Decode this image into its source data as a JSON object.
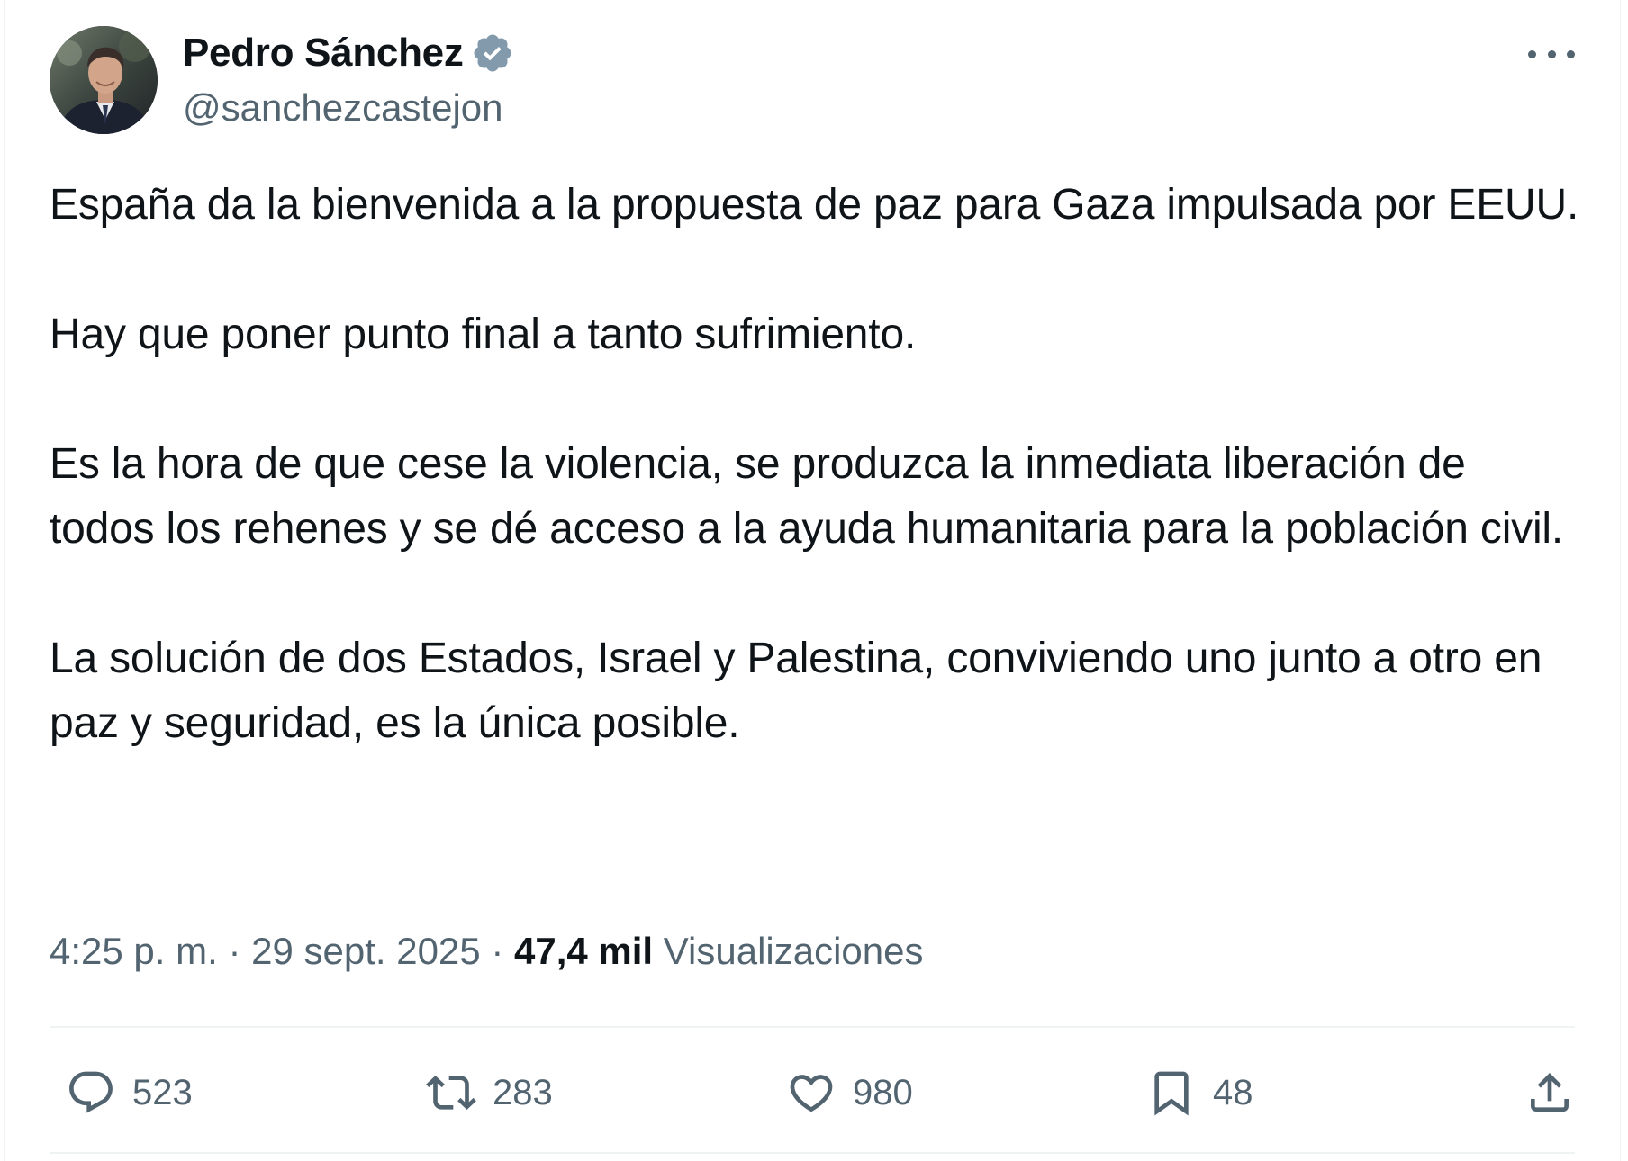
{
  "author": {
    "name": "Pedro Sánchez",
    "handle": "@sanchezcastejon",
    "verified": true
  },
  "icons": {
    "verified": "verified-badge-icon",
    "more": "more-options-icon",
    "reply": "reply-icon",
    "retweet": "retweet-icon",
    "like": "heart-icon",
    "bookmark": "bookmark-icon",
    "share": "share-icon"
  },
  "colors": {
    "text": "#0f1419",
    "secondary": "#536471",
    "verified": "#829aab",
    "divider": "#eff3f4"
  },
  "tweet": {
    "paragraphs": [
      "España da la bienvenida a la propuesta de paz para Gaza impulsada por EEUU.",
      "Hay que poner punto final a tanto sufrimiento.",
      "Es la hora de que cese la violencia, se produzca la inmediata liberación de todos los rehenes y se dé acceso a la ayuda humanitaria para la población civil.",
      "La solución de dos Estados, Israel y Palestina, conviviendo uno junto a otro en paz y seguridad, es la única posible."
    ]
  },
  "meta": {
    "time": "4:25 p. m.",
    "separator": "·",
    "date": "29 sept. 2025",
    "views_count": "47,4 mil",
    "views_label": "Visualizaciones"
  },
  "actions": {
    "replies": "523",
    "retweets": "283",
    "likes": "980",
    "bookmarks": "48"
  }
}
